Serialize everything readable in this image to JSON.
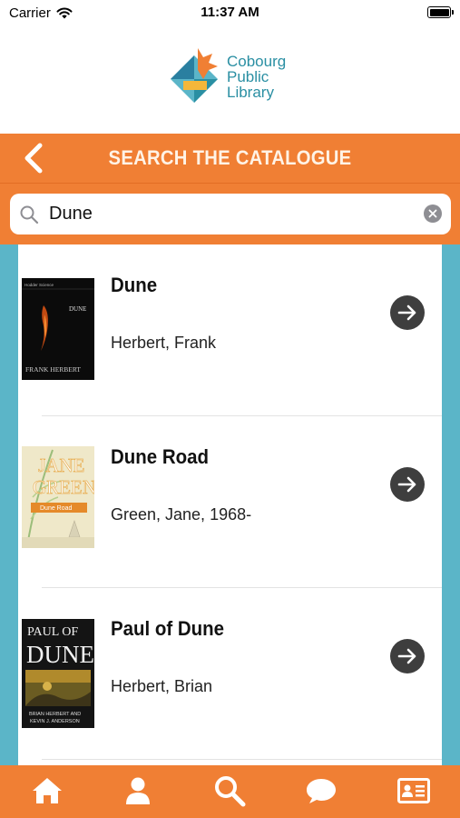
{
  "status_bar": {
    "carrier": "Carrier",
    "time": "11:37 AM"
  },
  "logo": {
    "line1": "Cobourg",
    "line2": "Public",
    "line3": "Library"
  },
  "header": {
    "title": "SEARCH THE CATALOGUE",
    "back_icon": "chevron-left-icon"
  },
  "search": {
    "value": "Dune",
    "icon": "search-icon",
    "clear_icon": "clear-icon"
  },
  "results": [
    {
      "title": "Dune",
      "author": "Herbert, Frank",
      "cover": {
        "top_text": "Hodder Science",
        "title_text": "DUNE",
        "author_text": "FRANK HERBERT"
      }
    },
    {
      "title": "Dune Road",
      "author": "Green, Jane, 1968-",
      "cover": {
        "line1": "JANE",
        "line2": "GREEN",
        "band_text": "Dune Road"
      }
    },
    {
      "title": "Paul of Dune",
      "author": "Herbert, Brian",
      "cover": {
        "line1": "PAUL OF",
        "line2": "DUNE",
        "author_line1": "BRIAN HERBERT AND",
        "author_line2": "KEVIN J. ANDERSON"
      }
    }
  ],
  "tabs": [
    {
      "name": "home",
      "icon": "home-icon"
    },
    {
      "name": "account",
      "icon": "user-icon"
    },
    {
      "name": "search",
      "icon": "search-icon"
    },
    {
      "name": "chat",
      "icon": "chat-icon"
    },
    {
      "name": "library-card",
      "icon": "id-card-icon"
    }
  ],
  "colors": {
    "accent": "#f07f34",
    "teal": "#5bb5c8",
    "arrow_button": "#3e3e3e"
  }
}
